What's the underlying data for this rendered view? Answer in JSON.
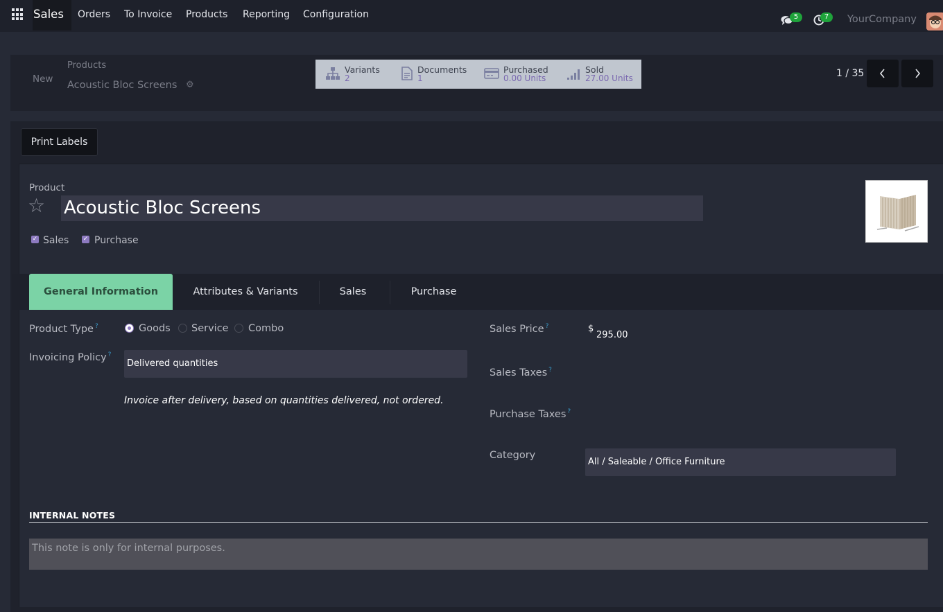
{
  "navbar": {
    "brand": "Sales",
    "menus": [
      "Orders",
      "To Invoice",
      "Products",
      "Reporting",
      "Configuration"
    ],
    "messages_count": "5",
    "activities_count": "7",
    "company": "YourCompany"
  },
  "breadcrumb": {
    "new_label": "New",
    "parent": "Products",
    "current": "Acoustic Bloc Screens"
  },
  "smart_buttons": [
    {
      "label": "Variants",
      "value": "2",
      "icon": "sitemap-icon"
    },
    {
      "label": "Documents",
      "value": "1",
      "icon": "document-icon"
    },
    {
      "label": "Purchased",
      "value": "0.00 Units",
      "icon": "credit-card-icon"
    },
    {
      "label": "Sold",
      "value": "27.00 Units",
      "icon": "signal-bars-icon"
    }
  ],
  "pager": {
    "value": "1 / 35"
  },
  "actions": {
    "print_labels": "Print Labels"
  },
  "product": {
    "label": "Product",
    "name": "Acoustic Bloc Screens",
    "can_be_sold": "Sales",
    "can_be_purchased": "Purchase"
  },
  "tabs": [
    "General Information",
    "Attributes & Variants",
    "Sales",
    "Purchase"
  ],
  "form": {
    "product_type_label": "Product Type",
    "type_options": [
      "Goods",
      "Service",
      "Combo"
    ],
    "selected_type": "Goods",
    "invoicing_policy_label": "Invoicing Policy",
    "invoicing_policy_value": "Delivered quantities",
    "invoicing_hint": "Invoice after delivery, based on quantities delivered, not ordered.",
    "sales_price_label": "Sales Price",
    "currency": "$",
    "sales_price": "295.00",
    "sales_taxes_label": "Sales Taxes",
    "purchase_taxes_label": "Purchase Taxes",
    "category_label": "Category",
    "category_value": "All / Saleable / Office Furniture",
    "help_mark": "?"
  },
  "notes": {
    "title": "INTERNAL NOTES",
    "placeholder": "This note is only for internal purposes."
  },
  "colors": {
    "background": "#262a36",
    "accent_tab": "#7bd3a6",
    "checkbox": "#8d7ac0",
    "badge": "#1fa33b"
  }
}
